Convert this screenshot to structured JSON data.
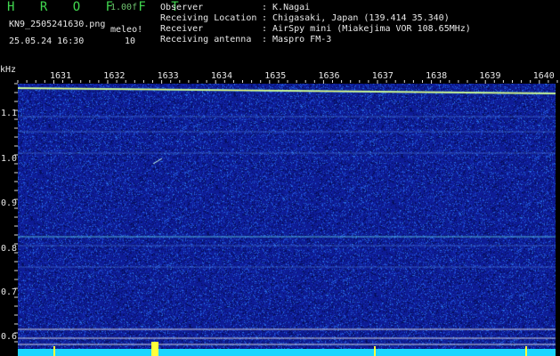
{
  "header": {
    "app_title": "H R O F F T",
    "version": "1.00f",
    "filename": "KN9_2505241630.png",
    "datetime": "25.05.24 16:30",
    "meleo_label": "meleo!",
    "meleo_value": "10"
  },
  "meta": {
    "rows": [
      {
        "label": "Observer",
        "value": ": K.Nagai"
      },
      {
        "label": "Receiving Location",
        "value": ": Chigasaki, Japan (139.414 35.340)"
      },
      {
        "label": "Receiver",
        "value": ": AirSpy mini (Miakejima VOR 108.65MHz)"
      },
      {
        "label": "Receiving antenna",
        "value": ": Maspro FM-3"
      }
    ]
  },
  "axis": {
    "unit": "kHz",
    "time_ticks": [
      "1631",
      "1632",
      "1633",
      "1634",
      "1635",
      "1636",
      "1637",
      "1638",
      "1639",
      "1640"
    ],
    "freq_ticks": [
      "1.1",
      "1.0",
      "0.9",
      "0.8",
      "0.7",
      "0.6"
    ]
  },
  "colors": {
    "background": "#0b1a9a",
    "trace_cyan": "#19d6ff",
    "trace_yellow": "#ffff3a",
    "text": "#e8e8e8",
    "logo": "#41d84f"
  }
}
